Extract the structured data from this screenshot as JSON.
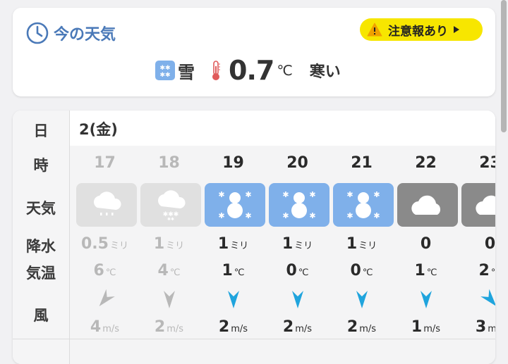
{
  "now": {
    "title": "今の天気",
    "alert_label": "注意報あり",
    "condition": "雪",
    "temperature": "0.7",
    "temp_unit": "℃",
    "feel": "寒い"
  },
  "forecast": {
    "row_labels": {
      "day": "日",
      "time": "時",
      "weather": "天気",
      "precip": "降水",
      "temp": "気温",
      "wind": "風"
    },
    "date": "2(金)",
    "precip_unit": "ミリ",
    "temp_unit": "℃",
    "wind_unit": "m/s",
    "hours": [
      {
        "hour": "17",
        "weather": "rain",
        "precip": "0.5",
        "precip_unit": "ミリ",
        "temp": "6",
        "wind": "4",
        "wind_unit": "m/s",
        "wind_dir": "northeast",
        "past": true
      },
      {
        "hour": "18",
        "weather": "sleet",
        "precip": "1",
        "precip_unit": "ミリ",
        "temp": "4",
        "wind": "2",
        "wind_unit": "m/s",
        "wind_dir": "north",
        "past": true
      },
      {
        "hour": "19",
        "weather": "snow",
        "precip": "1",
        "precip_unit": "ミリ",
        "temp": "1",
        "wind": "2",
        "wind_unit": "m/s",
        "wind_dir": "north",
        "past": false
      },
      {
        "hour": "20",
        "weather": "snow",
        "precip": "1",
        "precip_unit": "ミリ",
        "temp": "0",
        "wind": "2",
        "wind_unit": "m/s",
        "wind_dir": "north",
        "past": false
      },
      {
        "hour": "21",
        "weather": "snow",
        "precip": "1",
        "precip_unit": "ミリ",
        "temp": "0",
        "wind": "2",
        "wind_unit": "m/s",
        "wind_dir": "north",
        "past": false
      },
      {
        "hour": "22",
        "weather": "cloudy",
        "precip": "0",
        "precip_unit": "",
        "temp": "1",
        "wind": "1",
        "wind_unit": "m/s",
        "wind_dir": "north",
        "past": false
      },
      {
        "hour": "23",
        "weather": "cloudy",
        "precip": "0",
        "precip_unit": "",
        "temp": "2",
        "wind": "3",
        "wind_unit": "m/s",
        "wind_dir": "northwest",
        "past": false
      }
    ]
  },
  "colors": {
    "accent": "#4a79b8",
    "alert": "#f7e600",
    "snow": "#7fb0ea",
    "cloudy": "#8a8a8a",
    "past": "#e0e0e0",
    "wind_arrow": "#1fa4dd"
  }
}
